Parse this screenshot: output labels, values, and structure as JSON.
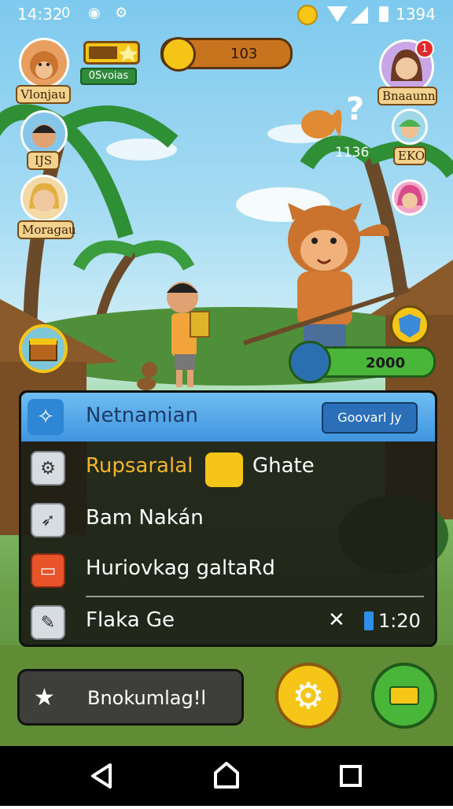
{
  "status_bar": {
    "time": "14:32",
    "clock_digit": "0",
    "right_text": "1394",
    "icons": [
      "circle-o-icon",
      "settings-icon",
      "coin-icon",
      "wifi-icon",
      "signal-icon",
      "battery-icon"
    ]
  },
  "hud": {
    "level_ribbon": "0Svoias",
    "coin_value": "103",
    "score_pill_value": "2000",
    "quest_counter": "1136",
    "quest_mark": "?",
    "notification_badge": "1"
  },
  "friends_left": [
    {
      "name": "Vlonjau"
    },
    {
      "name": "IJS"
    },
    {
      "name": "Moragau"
    }
  ],
  "friends_right": [
    {
      "name": "Bnaaunn"
    },
    {
      "name": "EKO"
    }
  ],
  "panel": {
    "header_title": "Netnamian",
    "header_button": "Goovarl Jy",
    "rows": [
      {
        "label": "Rupsaralal",
        "extra": "Ghate",
        "icon": "gear-icon",
        "color": "#f2b42a"
      },
      {
        "label": "Bam Nakán",
        "icon": "rocket-icon",
        "color": "#ffffff"
      },
      {
        "label": "Huriovkag galtaRd",
        "icon": "game-icon",
        "color": "#ffffff"
      },
      {
        "label": "Flaka Ge",
        "icon": "wrench-icon",
        "color": "#ffffff",
        "meta": "1:20"
      }
    ]
  },
  "bottom": {
    "main_button": "Bnokumlag!l"
  },
  "colors": {
    "accent_blue": "#3f95df",
    "accent_yellow": "#f5c518",
    "accent_green": "#49b63a"
  }
}
